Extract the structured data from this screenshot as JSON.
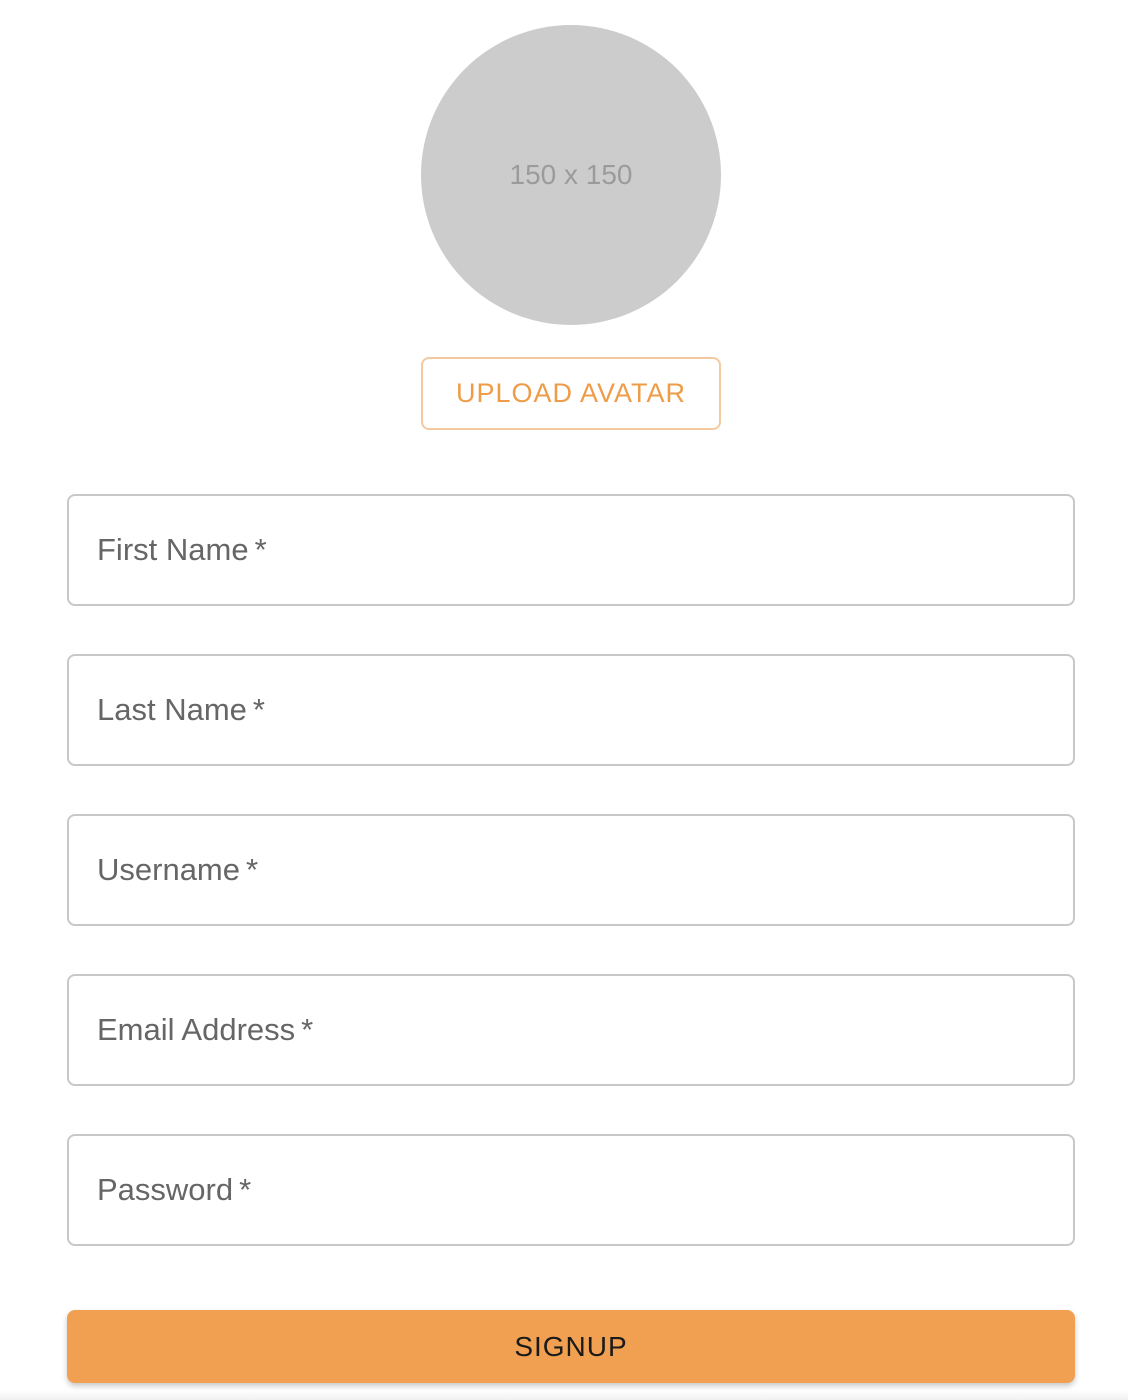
{
  "avatar": {
    "placeholder_text": "150 x 150"
  },
  "upload_button": {
    "label": "UPLOAD AVATAR"
  },
  "form": {
    "fields": [
      {
        "label": "First Name",
        "required_mark": "*",
        "value": ""
      },
      {
        "label": "Last Name",
        "required_mark": "*",
        "value": ""
      },
      {
        "label": "Username",
        "required_mark": "*",
        "value": ""
      },
      {
        "label": "Email Address",
        "required_mark": "*",
        "value": ""
      },
      {
        "label": "Password",
        "required_mark": "*",
        "value": ""
      }
    ]
  },
  "signup_button": {
    "label": "SIGNUP"
  },
  "colors": {
    "accent": "#f0a050",
    "accent_text": "#ee9c47",
    "avatar_bg": "#cccccc",
    "field_border": "#c8c8c8"
  }
}
